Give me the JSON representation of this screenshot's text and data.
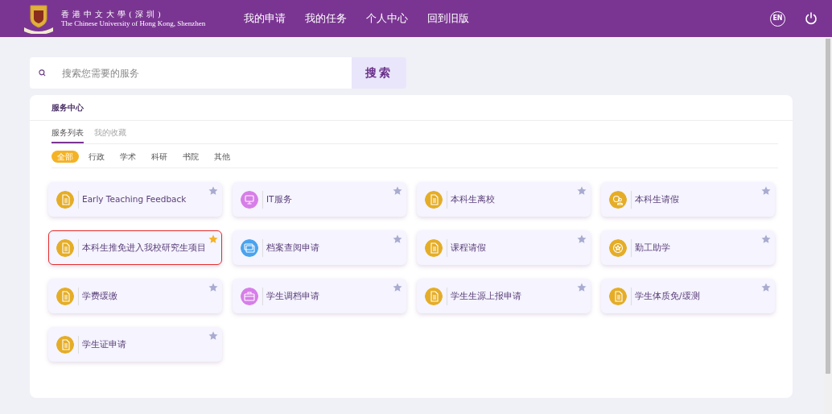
{
  "header": {
    "logo_cn": "香港中文大學(深圳)",
    "logo_en": "The Chinese University of Hong Kong, Shenzhen",
    "nav": [
      {
        "label": "我的申请"
      },
      {
        "label": "我的任务"
      },
      {
        "label": "个人中心"
      },
      {
        "label": "回到旧版"
      }
    ],
    "language": "EN"
  },
  "search": {
    "placeholder": "搜索您需要的服务",
    "button": "搜索"
  },
  "panel": {
    "title": "服务中心",
    "tabs": [
      {
        "label": "服务列表",
        "selected": true
      },
      {
        "label": "我的收藏",
        "selected": false
      }
    ],
    "filters": [
      {
        "label": "全部",
        "selected": true
      },
      {
        "label": "行政",
        "selected": false
      },
      {
        "label": "学术",
        "selected": false
      },
      {
        "label": "科研",
        "selected": false
      },
      {
        "label": "书院",
        "selected": false
      },
      {
        "label": "其他",
        "selected": false
      }
    ],
    "services": [
      {
        "name": "Early Teaching Feedback",
        "kind": "document",
        "color": "#e5ad27",
        "favorite": false,
        "selected": false
      },
      {
        "name": "IT服务",
        "kind": "monitor",
        "color": "#d77ee8",
        "favorite": false,
        "selected": false
      },
      {
        "name": "本科生离校",
        "kind": "document",
        "color": "#e5ad27",
        "favorite": false,
        "selected": false
      },
      {
        "name": "本科生请假",
        "kind": "person",
        "color": "#e5ad27",
        "favorite": false,
        "selected": false
      },
      {
        "name": "本科生推免进入我校研究生项目",
        "kind": "document",
        "color": "#e5ad27",
        "favorite": true,
        "selected": true
      },
      {
        "name": "档案查阅申请",
        "kind": "folders",
        "color": "#4aa3ee",
        "favorite": false,
        "selected": false
      },
      {
        "name": "课程请假",
        "kind": "document",
        "color": "#e5ad27",
        "favorite": false,
        "selected": false
      },
      {
        "name": "勤工助学",
        "kind": "medal",
        "color": "#e5ad27",
        "favorite": false,
        "selected": false
      },
      {
        "name": "学费缓缴",
        "kind": "document",
        "color": "#e5ad27",
        "favorite": false,
        "selected": false
      },
      {
        "name": "学生调档申请",
        "kind": "briefcase",
        "color": "#d77ee8",
        "favorite": false,
        "selected": false
      },
      {
        "name": "学生生源上报申请",
        "kind": "document",
        "color": "#e5ad27",
        "favorite": false,
        "selected": false
      },
      {
        "name": "学生体质免/缓测",
        "kind": "document",
        "color": "#e5ad27",
        "favorite": false,
        "selected": false
      },
      {
        "name": "学生证申请",
        "kind": "document",
        "color": "#e5ad27",
        "favorite": false,
        "selected": false
      }
    ]
  }
}
